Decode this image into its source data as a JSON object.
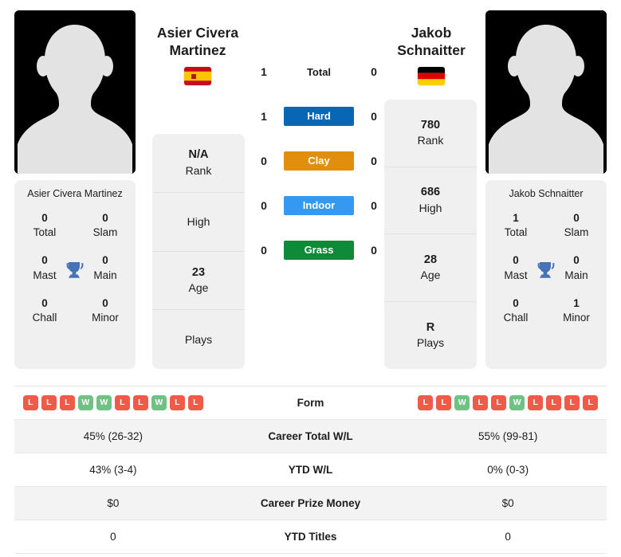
{
  "colors": {
    "hard": "#0767B5",
    "clay": "#E08E0B",
    "indoor": "#3399F3",
    "grass": "#0E8A38",
    "win": "#6FC184",
    "loss": "#EE5B48",
    "trophy": "#4573B8",
    "card_bg": "#F0F0F0",
    "row_shaded": "#F3F3F3"
  },
  "players": {
    "left": {
      "name_line1": "Asier Civera",
      "name_line2": "Martinez",
      "full_name": "Asier Civera Martinez",
      "flag": "spain-flag-icon",
      "avatar": "player-avatar-placeholder",
      "info": [
        {
          "value": "N/A",
          "key": "Rank"
        },
        {
          "value": "",
          "key": "High"
        },
        {
          "value": "23",
          "key": "Age"
        },
        {
          "value": "",
          "key": "Plays"
        }
      ],
      "titles": [
        {
          "value": "0",
          "key": "Total"
        },
        {
          "value": "0",
          "key": "Slam"
        },
        {
          "value": "0",
          "key": "Mast"
        },
        {
          "value": "0",
          "key": "Main"
        },
        {
          "value": "0",
          "key": "Chall"
        },
        {
          "value": "0",
          "key": "Minor"
        }
      ],
      "form": [
        "L",
        "L",
        "L",
        "W",
        "W",
        "L",
        "L",
        "W",
        "L",
        "L"
      ],
      "career_total_wl": "45% (26-32)",
      "ytd_wl": "43% (3-4)",
      "career_prize_money": "$0",
      "ytd_titles": "0"
    },
    "right": {
      "name_line1": "Jakob",
      "name_line2": "Schnaitter",
      "full_name": "Jakob Schnaitter",
      "flag": "germany-flag-icon",
      "avatar": "player-avatar-placeholder",
      "info": [
        {
          "value": "780",
          "key": "Rank"
        },
        {
          "value": "686",
          "key": "High"
        },
        {
          "value": "28",
          "key": "Age"
        },
        {
          "value": "R",
          "key": "Plays"
        }
      ],
      "titles": [
        {
          "value": "1",
          "key": "Total"
        },
        {
          "value": "0",
          "key": "Slam"
        },
        {
          "value": "0",
          "key": "Mast"
        },
        {
          "value": "0",
          "key": "Main"
        },
        {
          "value": "0",
          "key": "Chall"
        },
        {
          "value": "1",
          "key": "Minor"
        }
      ],
      "form": [
        "L",
        "L",
        "W",
        "L",
        "L",
        "W",
        "L",
        "L",
        "L",
        "L"
      ],
      "career_total_wl": "55% (99-81)",
      "ytd_wl": "0% (0-3)",
      "career_prize_money": "$0",
      "ytd_titles": "0"
    }
  },
  "h2h": [
    {
      "left": "1",
      "label": "Total",
      "right": "0",
      "style": "plain",
      "color": ""
    },
    {
      "left": "1",
      "label": "Hard",
      "right": "0",
      "style": "badge",
      "color": "#0767B5"
    },
    {
      "left": "0",
      "label": "Clay",
      "right": "0",
      "style": "badge",
      "color": "#E08E0B"
    },
    {
      "left": "0",
      "label": "Indoor",
      "right": "0",
      "style": "badge",
      "color": "#3399F3"
    },
    {
      "left": "0",
      "label": "Grass",
      "right": "0",
      "style": "badge",
      "color": "#0E8A38"
    }
  ],
  "table": {
    "rows": [
      {
        "type": "form",
        "label": "Form",
        "shaded": false
      },
      {
        "type": "text",
        "label": "Career Total W/L",
        "shaded": true,
        "left": "45% (26-32)",
        "right": "55% (99-81)"
      },
      {
        "type": "text",
        "label": "YTD W/L",
        "shaded": false,
        "left": "43% (3-4)",
        "right": "0% (0-3)"
      },
      {
        "type": "text",
        "label": "Career Prize Money",
        "shaded": true,
        "left": "$0",
        "right": "$0"
      },
      {
        "type": "text",
        "label": "YTD Titles",
        "shaded": false,
        "left": "0",
        "right": "0"
      }
    ]
  }
}
